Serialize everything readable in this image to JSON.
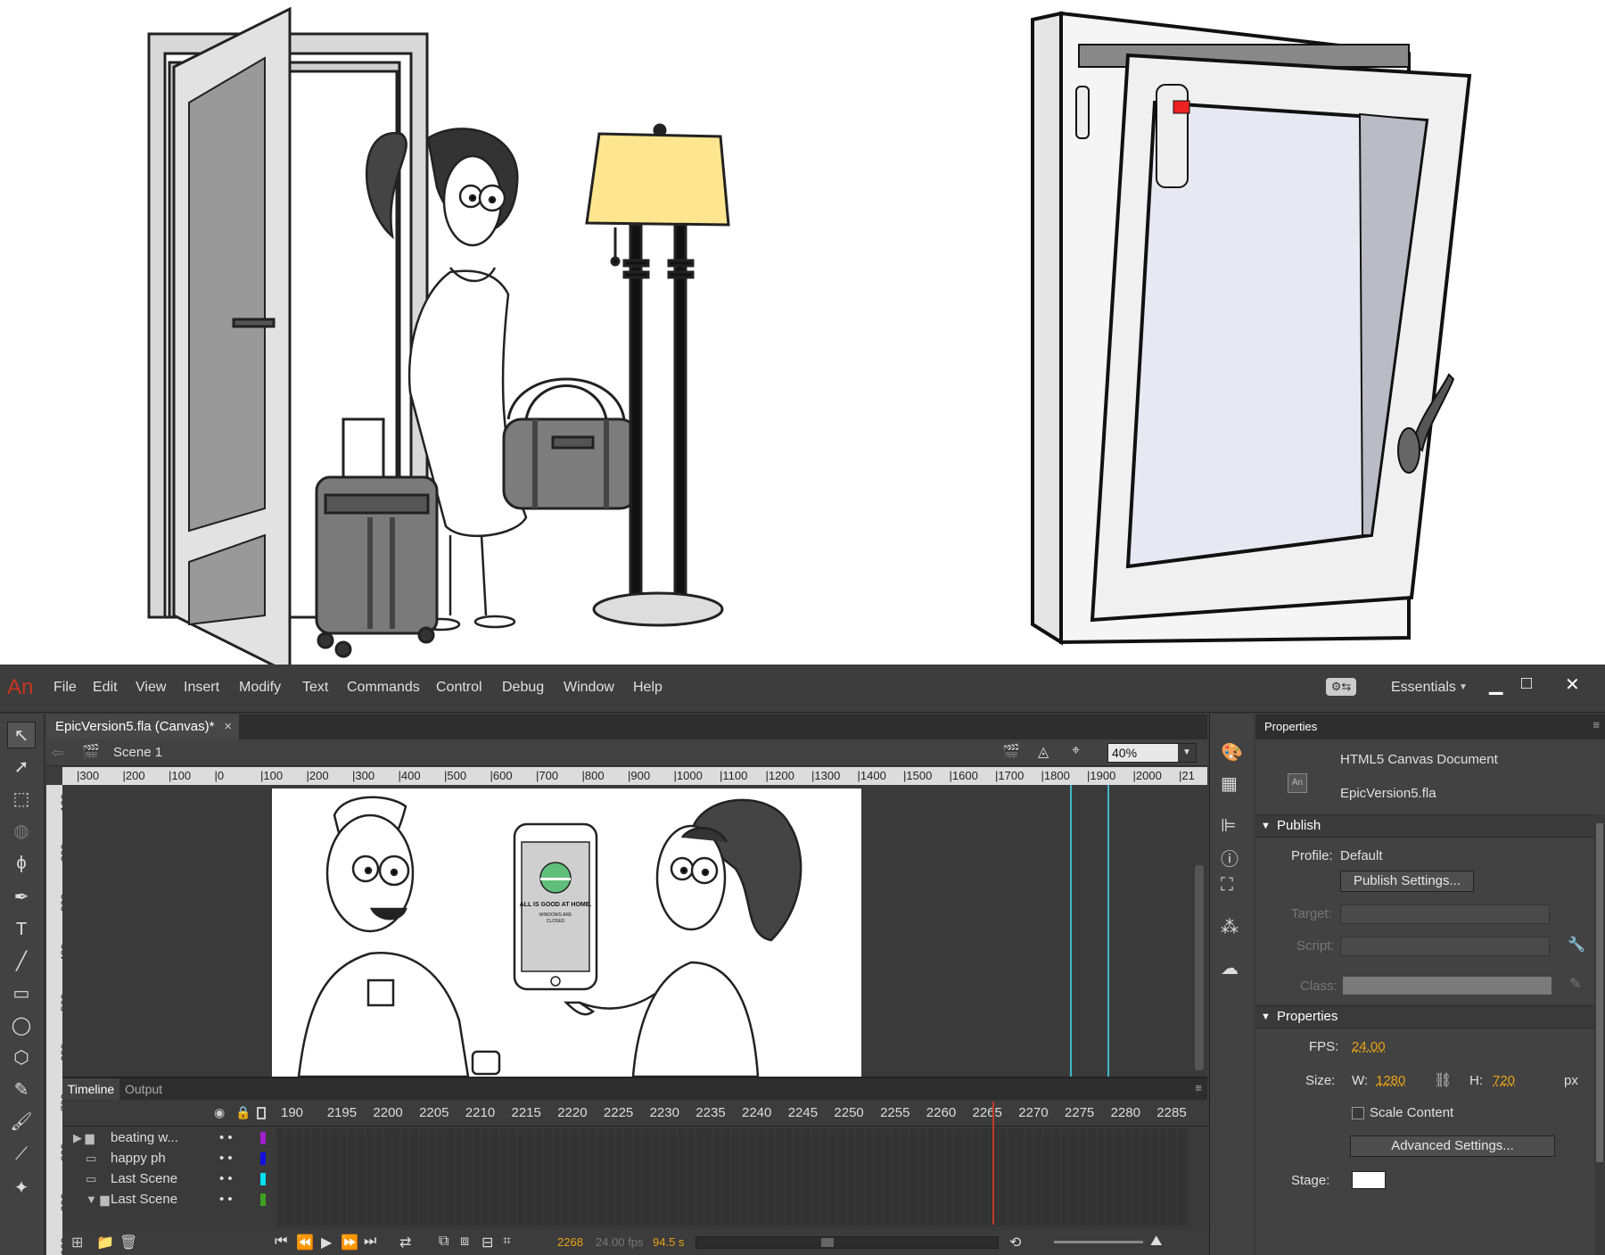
{
  "app": {
    "logo": "An",
    "menu": [
      "File",
      "Edit",
      "View",
      "Insert",
      "Modify",
      "Text",
      "Commands",
      "Control",
      "Debug",
      "Window",
      "Help"
    ],
    "workspace": "Essentials",
    "win_min": "▁",
    "win_max": "□",
    "win_close": "✕"
  },
  "document": {
    "tab_label": "EpicVersion5.fla (Canvas)*",
    "tab_close": "×",
    "scene": "Scene 1",
    "zoom": "40%"
  },
  "ruler_h": [
    "|300",
    "|200",
    "|100",
    "|0",
    "|100",
    "|200",
    "|300",
    "|400",
    "|500",
    "|600",
    "|700",
    "|800",
    "|900",
    "|1000",
    "|1100",
    "|1200",
    "|1300",
    "|1400",
    "|1500",
    "|1600",
    "|1700",
    "|1800",
    "|1900",
    "|2000",
    "|21"
  ],
  "ruler_v": [
    "100",
    "200",
    "300",
    "400",
    "500",
    "600",
    "700",
    "800",
    "900",
    "1000"
  ],
  "stage_phone": {
    "line1": "ALL IS GOOD AT HOME.",
    "line2": "WINDOWS ARE",
    "line3": "CLOSED"
  },
  "timeline": {
    "tabs": [
      "Timeline",
      "Output"
    ],
    "frame_numbers": [
      "190",
      "2195",
      "2200",
      "2205",
      "2210",
      "2215",
      "2220",
      "2225",
      "2230",
      "2235",
      "2240",
      "2245",
      "2250",
      "2255",
      "2260",
      "2265",
      "2270",
      "2275",
      "2280",
      "2285"
    ],
    "layers": [
      {
        "name": "beating w...",
        "color": "#a020d0"
      },
      {
        "name": "happy ph",
        "color": "#1010e0"
      },
      {
        "name": "Last Scene",
        "color": "#00e0f0"
      },
      {
        "name": "Last Scene",
        "color": "#40a020"
      }
    ],
    "current_frame": "2268",
    "fps_display": "24.00 fps",
    "time_display": "94.5 s"
  },
  "properties": {
    "panel_title": "Properties",
    "doc_type": "HTML5 Canvas Document",
    "doc_name": "EpicVersion5.fla",
    "publish_section": "Publish",
    "profile_label": "Profile:",
    "profile_value": "Default",
    "publish_settings_btn": "Publish Settings...",
    "target_label": "Target:",
    "script_label": "Script:",
    "class_label": "Class:",
    "props_section": "Properties",
    "fps_label": "FPS:",
    "fps_value": "24.00",
    "size_label": "Size:",
    "w_label": "W:",
    "w_value": "1280",
    "h_label": "H:",
    "h_value": "720",
    "unit": "px",
    "scale_content": "Scale Content",
    "advanced_btn": "Advanced Settings...",
    "stage_label": "Stage:",
    "stage_color": "#ffffff"
  },
  "colors": {
    "accent_orange": "#e8a317",
    "playhead_red": "#c0392b",
    "brand_red": "#c8361f"
  }
}
